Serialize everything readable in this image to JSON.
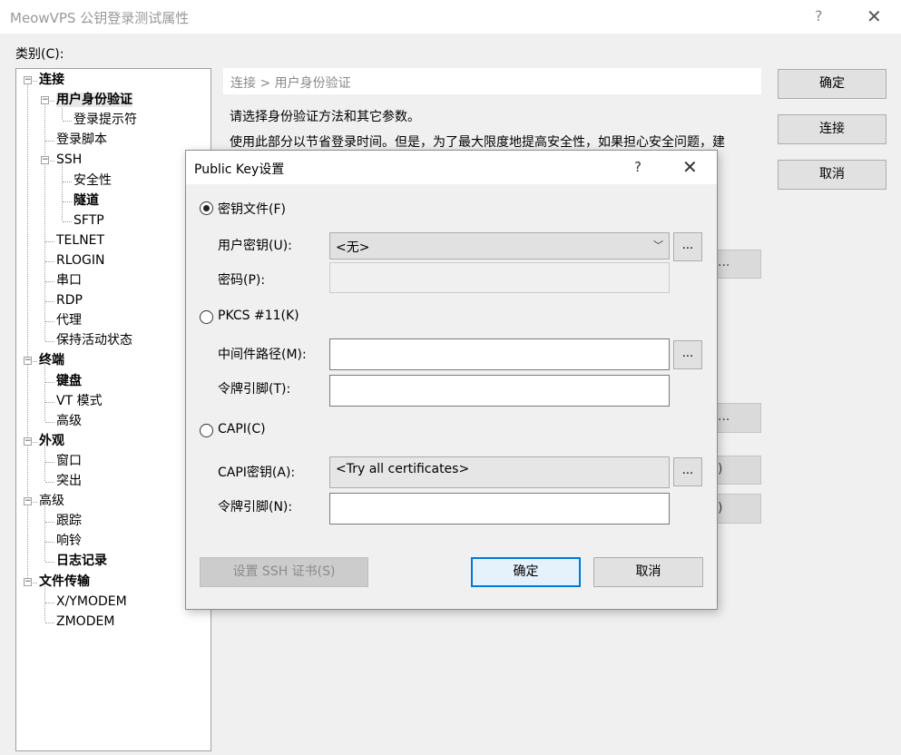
{
  "window": {
    "title": "MeowVPS 公钥登录测试属性",
    "help_glyph": "?",
    "close_glyph": "✕"
  },
  "category_label": "类别(C):",
  "tree": [
    {
      "label": "连接",
      "bold": true,
      "toggle": "−"
    },
    {
      "label": "用户身份验证",
      "bold": true,
      "toggle": "−",
      "selected": true
    },
    {
      "label": "登录提示符"
    },
    {
      "label": "登录脚本"
    },
    {
      "label": "SSH",
      "toggle": "−"
    },
    {
      "label": "安全性"
    },
    {
      "label": "隧道",
      "bold": true
    },
    {
      "label": "SFTP"
    },
    {
      "label": "TELNET"
    },
    {
      "label": "RLOGIN"
    },
    {
      "label": "串口"
    },
    {
      "label": "RDP"
    },
    {
      "label": "代理"
    },
    {
      "label": "保持活动状态"
    },
    {
      "label": "终端",
      "bold": true,
      "toggle": "−"
    },
    {
      "label": "键盘",
      "bold": true
    },
    {
      "label": "VT 模式"
    },
    {
      "label": "高级"
    },
    {
      "label": "外观",
      "bold": true,
      "toggle": "−"
    },
    {
      "label": "窗口"
    },
    {
      "label": "突出"
    },
    {
      "label": "高级",
      "toggle": "−"
    },
    {
      "label": "跟踪"
    },
    {
      "label": "响铃"
    },
    {
      "label": "日志记录",
      "bold": true
    },
    {
      "label": "文件传输",
      "bold": true,
      "toggle": "−"
    },
    {
      "label": "X/YMODEM"
    },
    {
      "label": "ZMODEM"
    }
  ],
  "panel": {
    "breadcrumb": "连接 > 用户身份验证",
    "desc1": "请选择身份验证方法和其它参数。",
    "desc2": "使用此部分以节省登录时间。但是，为了最大限度地提高安全性，如果担心安全问题，建",
    "ghost1": "...",
    "ghost2": "...",
    "ghost3": ")",
    "ghost4": ")"
  },
  "side_buttons": {
    "ok": "确定",
    "connect": "连接",
    "cancel": "取消"
  },
  "dialog": {
    "title": "Public Key设置",
    "help_glyph": "?",
    "close_glyph": "✕",
    "key_file_radio": "密钥文件(F)",
    "user_key_label": "用户密钥(U):",
    "user_key_value": "<无>",
    "password_label": "密码(P):",
    "password_value": "",
    "pkcs_radio": "PKCS #11(K)",
    "middleware_label": "中间件路径(M):",
    "middleware_value": "",
    "token_pin_label": "令牌引脚(T):",
    "token_pin_value": "",
    "capi_radio": "CAPI(C)",
    "capi_key_label": "CAPI密钥(A):",
    "capi_key_value": "<Try all certificates>",
    "capi_pin_label": "令牌引脚(N):",
    "capi_pin_value": "",
    "browse_label": "...",
    "ssh_cert_button": "设置 SSH 证书(S)",
    "ok_button": "确定",
    "cancel_button": "取消",
    "selected_method": "密钥文件(F)"
  },
  "colors": {
    "accent": "#0078d7",
    "title_grey": "#999999"
  }
}
